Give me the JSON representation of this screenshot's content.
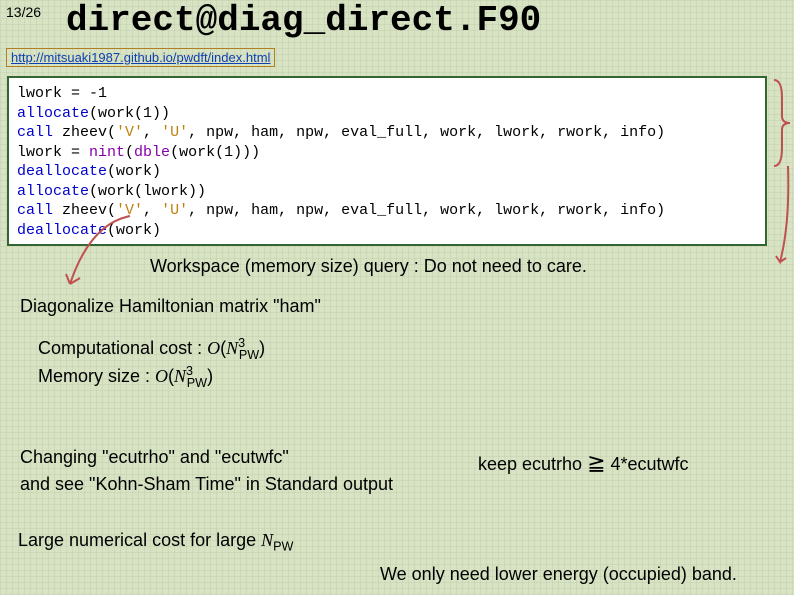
{
  "page_number": "13/26",
  "title": "direct@diag_direct.F90",
  "url": "http://mitsuaki1987.github.io/pwdft/index.html",
  "code": {
    "l1a": "lwork = -1",
    "l2a": "allocate",
    "l2b": "(work(1))",
    "l3a": "call",
    "l3b": " zheev(",
    "l3c": "'V'",
    "l3d": ", ",
    "l3e": "'U'",
    "l3f": ", npw, ham, npw, eval_full, work, lwork, rwork, info)",
    "l4a": "lwork = ",
    "l4b": "nint",
    "l4c": "(",
    "l4d": "dble",
    "l4e": "(work(1)))",
    "l5a": "deallocate",
    "l5b": "(work)",
    "l6a": "allocate",
    "l6b": "(work(lwork))",
    "l7a": "call",
    "l7b": " zheev(",
    "l7c": "'V'",
    "l7d": ", ",
    "l7e": "'U'",
    "l7f": ", npw, ham, npw, eval_full, work, lwork, rwork, info)",
    "l8a": "deallocate",
    "l8b": "(work)"
  },
  "workspace_text": "Workspace (memory size) query : Do not need to care.",
  "diag_text": "Diagonalize Hamiltonian matrix \"ham\"",
  "comp_label": "Computational cost : ",
  "mem_label": "Memory size : ",
  "bigO": "O",
  "npw_base": "N",
  "npw_sub": "PW",
  "cube": "3",
  "changing_l1": "Changing \"ecutrho\" and \"ecutwfc\"",
  "changing_l2": "and see \"Kohn-Sham Time\" in Standard output",
  "keep_text_a": "keep ecutrho ",
  "keep_text_b": " 4*ecutwfc",
  "geq": "≧",
  "large_cost": "Large numerical cost for large ",
  "only_need": "We only need lower energy (occupied) band."
}
